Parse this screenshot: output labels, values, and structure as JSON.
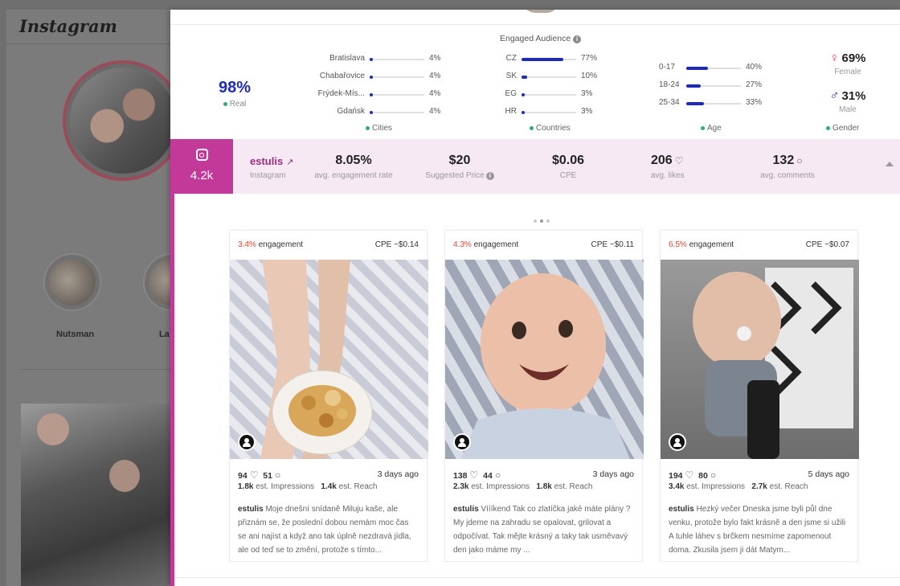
{
  "background": {
    "logo_text": "Instagram",
    "highlights": [
      {
        "label": "Nutsman"
      },
      {
        "label": "La"
      }
    ]
  },
  "audience": {
    "title": "Engaged Audience",
    "real": {
      "value": "98%",
      "label": "Real"
    },
    "cities": {
      "label": "Cities",
      "items": [
        {
          "name": "Bratislava",
          "pct": "4%",
          "fraction": 0.04
        },
        {
          "name": "Chabařovice",
          "pct": "4%",
          "fraction": 0.04
        },
        {
          "name": "Frýdek-Mís...",
          "pct": "4%",
          "fraction": 0.04
        },
        {
          "name": "Gdańsk",
          "pct": "4%",
          "fraction": 0.04
        }
      ]
    },
    "countries": {
      "label": "Countries",
      "items": [
        {
          "name": "CZ",
          "pct": "77%",
          "fraction": 0.77
        },
        {
          "name": "SK",
          "pct": "10%",
          "fraction": 0.1
        },
        {
          "name": "EG",
          "pct": "3%",
          "fraction": 0.03
        },
        {
          "name": "HR",
          "pct": "3%",
          "fraction": 0.03
        }
      ]
    },
    "age": {
      "label": "Age",
      "items": [
        {
          "name": "0-17",
          "pct": "40%",
          "fraction": 0.4
        },
        {
          "name": "18-24",
          "pct": "27%",
          "fraction": 0.27
        },
        {
          "name": "25-34",
          "pct": "33%",
          "fraction": 0.33
        }
      ]
    },
    "gender": {
      "label": "Gender",
      "female": {
        "value": "69%",
        "label": "Female"
      },
      "male": {
        "value": "31%",
        "label": "Male"
      }
    }
  },
  "stats": {
    "platform_count": "4.2k",
    "handle": "estulis",
    "platform": "Instagram",
    "engagement_rate": {
      "value": "8.05%",
      "label": "avg. engagement rate"
    },
    "suggested_price": {
      "value": "$20",
      "label": "Suggested Price"
    },
    "cpe": {
      "value": "$0.06",
      "label": "CPE"
    },
    "avg_likes": {
      "value": "206",
      "label": "avg. likes"
    },
    "avg_comments": {
      "value": "132",
      "label": "avg. comments"
    }
  },
  "posts": [
    {
      "engagement_pct": "3.4%",
      "engagement_word": "engagement",
      "cpe": "CPE ~$0.14",
      "likes": "94",
      "comments": "51",
      "ago": "3 days ago",
      "impressions": "1.8k",
      "impressions_label": "est. Impressions",
      "reach": "1.4k",
      "reach_label": "est. Reach",
      "author": "estulis",
      "caption": "Moje dnešní snídaně Miluju kaše, ale přiznám se, že poslední dobou nemám moc čas se ani najíst a když ano tak úplně nezdravá jídla, ale od teď se to změní, protože s tímto..."
    },
    {
      "engagement_pct": "4.3%",
      "engagement_word": "engagement",
      "cpe": "CPE ~$0.11",
      "likes": "138",
      "comments": "44",
      "ago": "3 days ago",
      "impressions": "2.3k",
      "impressions_label": "est. Impressions",
      "reach": "1.8k",
      "reach_label": "est. Reach",
      "author": "estulis",
      "caption": "Víííkend Tak co zlatíčka jaké máte plány ? My jdeme na zahradu se opalovat, grilovat a odpočívat. Tak mějte krásný a taky tak usměvavý den jako máme my ..."
    },
    {
      "engagement_pct": "6.5%",
      "engagement_word": "engagement",
      "cpe": "CPE ~$0.07",
      "likes": "194",
      "comments": "80",
      "ago": "5 days ago",
      "impressions": "3.4k",
      "impressions_label": "est. Impressions",
      "reach": "2.7k",
      "reach_label": "est. Reach",
      "author": "estulis",
      "caption": "Hezký večer Dneska jsme byli půl dne venku, protože bylo fakt krásně a den jsme si užili A tuhle láhev s brčkem nesmíme zapomenout doma. Zkusila jsem ji dát Matym..."
    }
  ],
  "colors": {
    "accent": "#c2399a",
    "bar": "#1d2bb8",
    "engagement": "#e0452f",
    "real_dot": "#27b36a"
  }
}
